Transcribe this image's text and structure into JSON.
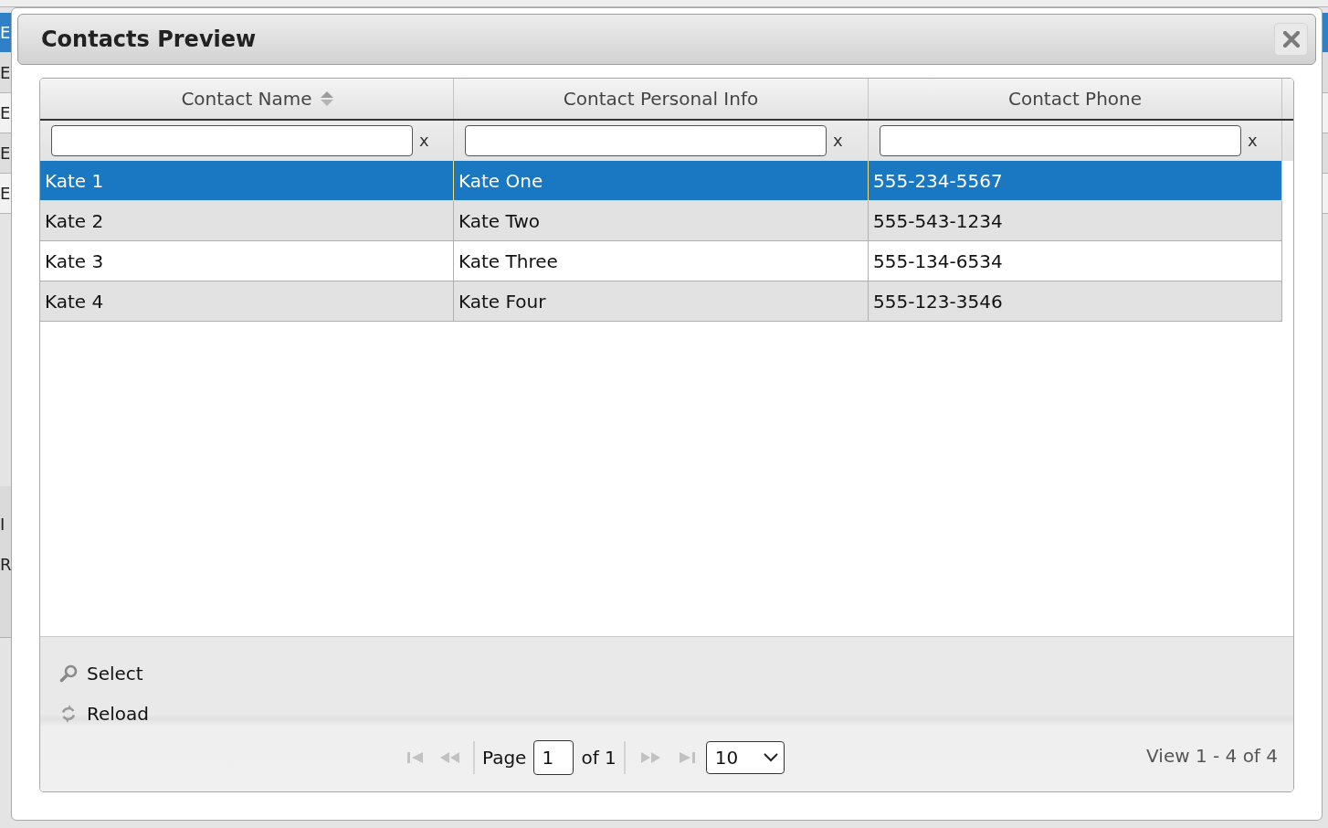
{
  "background_page": {
    "edge_rows": [
      {
        "text": "E",
        "selected": true
      },
      {
        "text": "E",
        "selected": false
      },
      {
        "text": "E",
        "selected": false
      },
      {
        "text": "E",
        "selected": false
      },
      {
        "text": "E",
        "selected": false
      }
    ],
    "edge_labels": [
      "I",
      "R"
    ]
  },
  "dialog": {
    "title": "Contacts Preview",
    "grid": {
      "columns": [
        {
          "label": "Contact Name",
          "sortable": true
        },
        {
          "label": "Contact Personal Info",
          "sortable": false
        },
        {
          "label": "Contact Phone",
          "sortable": false
        }
      ],
      "filters": [
        {
          "clear": "x"
        },
        {
          "clear": "x"
        },
        {
          "clear": "x"
        }
      ],
      "rows": [
        {
          "cells": [
            "Kate 1",
            "Kate One",
            "555-234-5567"
          ],
          "selected": true
        },
        {
          "cells": [
            "Kate 2",
            "Kate Two",
            "555-543-1234"
          ],
          "selected": false
        },
        {
          "cells": [
            "Kate 3",
            "Kate Three",
            "555-134-6534"
          ],
          "selected": false
        },
        {
          "cells": [
            "Kate 4",
            "Kate Four",
            "555-123-3546"
          ],
          "selected": false
        }
      ]
    },
    "toolbar": [
      {
        "kind": "select",
        "label": "Select"
      },
      {
        "kind": "reload",
        "label": "Reload"
      }
    ],
    "pager": {
      "nav": [
        {
          "kind": "first",
          "disabled": true
        },
        {
          "kind": "prev",
          "disabled": true
        },
        {
          "kind": "next",
          "disabled": true
        },
        {
          "kind": "last",
          "disabled": true
        }
      ],
      "page_label": "Page",
      "page_value": "1",
      "page_count": "of 1",
      "page_size": "10",
      "summary": "View 1 - 4 of 4"
    }
  }
}
